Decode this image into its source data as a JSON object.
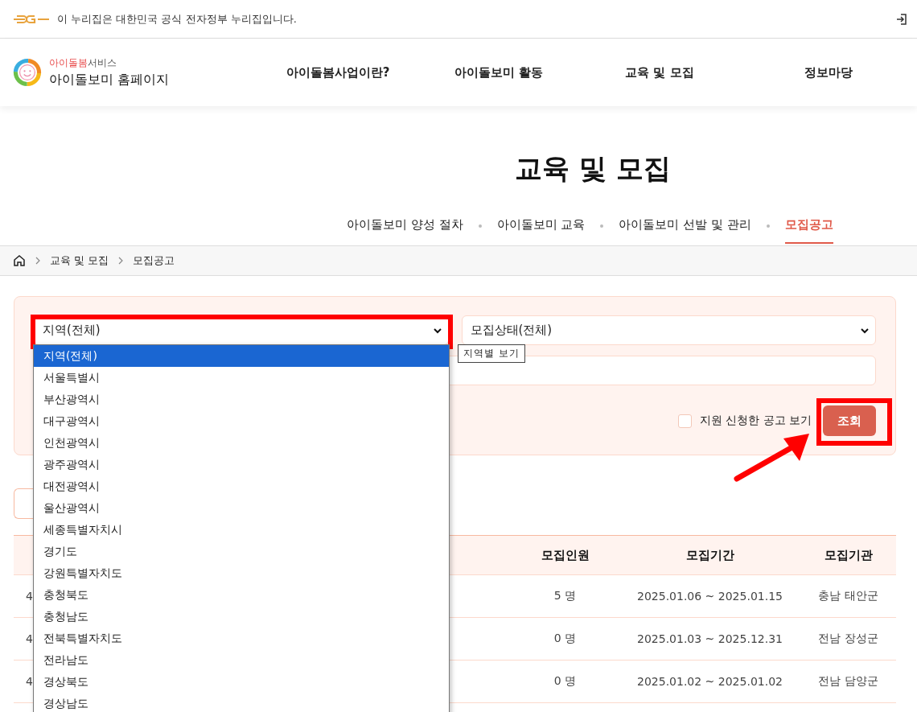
{
  "gov_banner": {
    "text": "이 누리집은 대한민국 공식 전자정부 누리집입니다."
  },
  "header": {
    "brand_highlight": "아이돌봄",
    "brand_rest": "서비스",
    "site_name": "아이돌보미 홈페이지",
    "nav": [
      "아이돌봄사업이란?",
      "아이돌보미 활동",
      "교육 및 모집",
      "정보마당"
    ]
  },
  "page_title": "교육 및 모집",
  "sub_tabs": [
    {
      "label": "아이돌보미 양성 절차",
      "selected": false
    },
    {
      "label": "아이돌보미 교육",
      "selected": false
    },
    {
      "label": "아이돌보미 선발 및 관리",
      "selected": false
    },
    {
      "label": "모집공고",
      "selected": true
    }
  ],
  "breadcrumb": [
    "교육 및 모집",
    "모집공고"
  ],
  "filters": {
    "region_select": {
      "value": "지역(전체)",
      "expanded": true
    },
    "status_select": {
      "value": "모집상태(전체)"
    },
    "tooltip": "지역별 보기",
    "applied_only": {
      "label": "지원 신청한 공고 보기",
      "checked": false
    },
    "search_button": "조회"
  },
  "region_options": [
    {
      "label": "지역(전체)",
      "selected": true
    },
    {
      "label": "서울특별시",
      "selected": false
    },
    {
      "label": "부산광역시",
      "selected": false
    },
    {
      "label": "대구광역시",
      "selected": false
    },
    {
      "label": "인천광역시",
      "selected": false
    },
    {
      "label": "광주광역시",
      "selected": false
    },
    {
      "label": "대전광역시",
      "selected": false
    },
    {
      "label": "울산광역시",
      "selected": false
    },
    {
      "label": "세종특별자치시",
      "selected": false
    },
    {
      "label": "경기도",
      "selected": false
    },
    {
      "label": "강원특별자치도",
      "selected": false
    },
    {
      "label": "충청북도",
      "selected": false
    },
    {
      "label": "충청남도",
      "selected": false
    },
    {
      "label": "전북특별자치도",
      "selected": false
    },
    {
      "label": "전라남도",
      "selected": false
    },
    {
      "label": "경상북도",
      "selected": false
    },
    {
      "label": "경상남도",
      "selected": false
    }
  ],
  "table": {
    "columns": [
      "",
      "모집인원",
      "모집기간",
      "모집기관"
    ],
    "rows": [
      [
        "4",
        "5 명",
        "2025.01.06 ~ 2025.01.15",
        "충남 태안군"
      ],
      [
        "4",
        "0 명",
        "2025.01.03 ~ 2025.12.31",
        "전남 장성군"
      ],
      [
        "4",
        "0 명",
        "2025.01.02 ~ 2025.01.02",
        "전남 담양군"
      ]
    ]
  }
}
